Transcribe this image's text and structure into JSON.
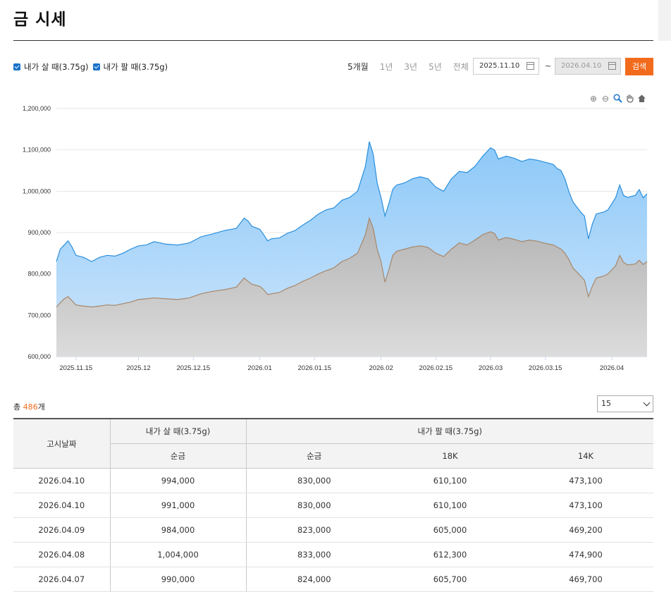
{
  "page": {
    "title": "금 시세"
  },
  "legend": {
    "buy_label": "내가 살 때(3.75g)",
    "sell_label": "내가 팔 때(3.75g)"
  },
  "periods": [
    "5개월",
    "1년",
    "3년",
    "5년",
    "전체"
  ],
  "date_range": {
    "start": "2025.11.10",
    "end": "2026.04.10",
    "separator": "~"
  },
  "search_label": "검색",
  "summary": {
    "prefix": "총 ",
    "count": "486",
    "suffix": "개"
  },
  "page_size": "15",
  "table": {
    "header_date": "고시날짜",
    "header_buy": "내가 살 때(3.75g)",
    "header_sell": "내가 팔 때(3.75g)",
    "sub": [
      "순금",
      "순금",
      "18K",
      "14K"
    ],
    "rows": [
      [
        "2026.04.10",
        "994,000",
        "830,000",
        "610,100",
        "473,100"
      ],
      [
        "2026.04.10",
        "991,000",
        "830,000",
        "610,100",
        "473,100"
      ],
      [
        "2026.04.09",
        "984,000",
        "823,000",
        "605,000",
        "469,200"
      ],
      [
        "2026.04.08",
        "1,004,000",
        "833,000",
        "612,300",
        "474,900"
      ],
      [
        "2026.04.07",
        "990,000",
        "824,000",
        "605,700",
        "469,700"
      ]
    ]
  },
  "colors": {
    "buy_fill": "#8cc8f8",
    "buy_line": "#2a8fdc",
    "sell_fill": "#b3b3b3",
    "sell_line": "#a8876a",
    "accent": "#f26b1d"
  },
  "chart_data": {
    "type": "area",
    "ylim": [
      600000,
      1200000
    ],
    "y_ticks": [
      "1,200,000",
      "1,100,000",
      "1,000,000",
      "900,000",
      "800,000",
      "700,000",
      "600,000"
    ],
    "x_ticks": [
      "2025.11.15",
      "2025.12",
      "2025.12.15",
      "2026.01",
      "2026.01.15",
      "2026.02",
      "2026.02.15",
      "2026.03",
      "2026.03.15",
      "2026.04"
    ],
    "x_range": [
      "2025.11.10",
      "2026.04.10"
    ],
    "grid": true,
    "series": [
      {
        "name": "내가 살 때(3.75g)",
        "points": [
          [
            "2025.11.10",
            830000
          ],
          [
            "2025.11.11",
            860000
          ],
          [
            "2025.11.12",
            870000
          ],
          [
            "2025.11.13",
            880000
          ],
          [
            "2025.11.14",
            865000
          ],
          [
            "2025.11.15",
            845000
          ],
          [
            "2025.11.17",
            840000
          ],
          [
            "2025.11.19",
            830000
          ],
          [
            "2025.11.21",
            840000
          ],
          [
            "2025.11.23",
            845000
          ],
          [
            "2025.11.25",
            843000
          ],
          [
            "2025.11.27",
            850000
          ],
          [
            "2025.11.29",
            860000
          ],
          [
            "2025.12.01",
            868000
          ],
          [
            "2025.12.03",
            870000
          ],
          [
            "2025.12.05",
            878000
          ],
          [
            "2025.12.08",
            872000
          ],
          [
            "2025.12.11",
            870000
          ],
          [
            "2025.12.14",
            875000
          ],
          [
            "2025.12.17",
            890000
          ],
          [
            "2025.12.20",
            897000
          ],
          [
            "2025.12.23",
            905000
          ],
          [
            "2025.12.26",
            910000
          ],
          [
            "2025.12.28",
            935000
          ],
          [
            "2025.12.29",
            928000
          ],
          [
            "2025.12.30",
            915000
          ],
          [
            "2026.01.01",
            908000
          ],
          [
            "2026.01.02",
            895000
          ],
          [
            "2026.01.03",
            880000
          ],
          [
            "2026.01.04",
            885000
          ],
          [
            "2026.01.06",
            887000
          ],
          [
            "2026.01.08",
            898000
          ],
          [
            "2026.01.10",
            905000
          ],
          [
            "2026.01.12",
            918000
          ],
          [
            "2026.01.14",
            930000
          ],
          [
            "2026.01.16",
            945000
          ],
          [
            "2026.01.18",
            955000
          ],
          [
            "2026.01.20",
            960000
          ],
          [
            "2026.01.22",
            978000
          ],
          [
            "2026.01.24",
            985000
          ],
          [
            "2026.01.26",
            1000000
          ],
          [
            "2026.01.28",
            1060000
          ],
          [
            "2026.01.29",
            1120000
          ],
          [
            "2026.01.30",
            1090000
          ],
          [
            "2026.01.31",
            1020000
          ],
          [
            "2026.02.01",
            985000
          ],
          [
            "2026.02.02",
            940000
          ],
          [
            "2026.02.03",
            970000
          ],
          [
            "2026.02.04",
            1005000
          ],
          [
            "2026.02.05",
            1015000
          ],
          [
            "2026.02.07",
            1020000
          ],
          [
            "2026.02.09",
            1030000
          ],
          [
            "2026.02.11",
            1035000
          ],
          [
            "2026.02.13",
            1030000
          ],
          [
            "2026.02.15",
            1010000
          ],
          [
            "2026.02.17",
            1000000
          ],
          [
            "2026.02.19",
            1030000
          ],
          [
            "2026.02.21",
            1048000
          ],
          [
            "2026.02.23",
            1045000
          ],
          [
            "2026.02.25",
            1060000
          ],
          [
            "2026.02.27",
            1085000
          ],
          [
            "2026.03.01",
            1105000
          ],
          [
            "2026.03.02",
            1100000
          ],
          [
            "2026.03.03",
            1078000
          ],
          [
            "2026.03.05",
            1085000
          ],
          [
            "2026.03.07",
            1080000
          ],
          [
            "2026.03.09",
            1072000
          ],
          [
            "2026.03.11",
            1078000
          ],
          [
            "2026.03.13",
            1075000
          ],
          [
            "2026.03.15",
            1070000
          ],
          [
            "2026.03.17",
            1065000
          ],
          [
            "2026.03.18",
            1055000
          ],
          [
            "2026.03.19",
            1050000
          ],
          [
            "2026.03.20",
            1030000
          ],
          [
            "2026.03.21",
            1000000
          ],
          [
            "2026.03.22",
            975000
          ],
          [
            "2026.03.24",
            950000
          ],
          [
            "2026.03.25",
            940000
          ],
          [
            "2026.03.26",
            885000
          ],
          [
            "2026.03.27",
            920000
          ],
          [
            "2026.03.28",
            945000
          ],
          [
            "2026.03.30",
            950000
          ],
          [
            "2026.03.31",
            955000
          ],
          [
            "2026.04.01",
            970000
          ],
          [
            "2026.04.02",
            985000
          ],
          [
            "2026.04.03",
            1015000
          ],
          [
            "2026.04.04",
            990000
          ],
          [
            "2026.04.05",
            985000
          ],
          [
            "2026.04.07",
            990000
          ],
          [
            "2026.04.08",
            1004000
          ],
          [
            "2026.04.09",
            984000
          ],
          [
            "2026.04.10",
            994000
          ]
        ]
      },
      {
        "name": "내가 팔 때(3.75g)",
        "points": [
          [
            "2025.11.10",
            720000
          ],
          [
            "2025.11.11",
            730000
          ],
          [
            "2025.11.12",
            740000
          ],
          [
            "2025.11.13",
            745000
          ],
          [
            "2025.11.14",
            735000
          ],
          [
            "2025.11.15",
            725000
          ],
          [
            "2025.11.17",
            722000
          ],
          [
            "2025.11.19",
            720000
          ],
          [
            "2025.11.21",
            722000
          ],
          [
            "2025.11.23",
            725000
          ],
          [
            "2025.11.25",
            724000
          ],
          [
            "2025.11.27",
            728000
          ],
          [
            "2025.11.29",
            732000
          ],
          [
            "2025.12.01",
            738000
          ],
          [
            "2025.12.03",
            740000
          ],
          [
            "2025.12.05",
            742000
          ],
          [
            "2025.12.08",
            740000
          ],
          [
            "2025.12.11",
            738000
          ],
          [
            "2025.12.14",
            742000
          ],
          [
            "2025.12.17",
            752000
          ],
          [
            "2025.12.20",
            758000
          ],
          [
            "2025.12.23",
            762000
          ],
          [
            "2025.12.26",
            768000
          ],
          [
            "2025.12.28",
            790000
          ],
          [
            "2025.12.29",
            782000
          ],
          [
            "2025.12.30",
            775000
          ],
          [
            "2026.01.01",
            770000
          ],
          [
            "2026.01.02",
            762000
          ],
          [
            "2026.01.03",
            750000
          ],
          [
            "2026.01.04",
            752000
          ],
          [
            "2026.01.06",
            755000
          ],
          [
            "2026.01.08",
            765000
          ],
          [
            "2026.01.10",
            772000
          ],
          [
            "2026.01.12",
            782000
          ],
          [
            "2026.01.14",
            790000
          ],
          [
            "2026.01.16",
            800000
          ],
          [
            "2026.01.18",
            808000
          ],
          [
            "2026.01.20",
            815000
          ],
          [
            "2026.01.22",
            830000
          ],
          [
            "2026.01.24",
            838000
          ],
          [
            "2026.01.26",
            850000
          ],
          [
            "2026.01.28",
            895000
          ],
          [
            "2026.01.29",
            935000
          ],
          [
            "2026.01.30",
            910000
          ],
          [
            "2026.01.31",
            860000
          ],
          [
            "2026.02.01",
            830000
          ],
          [
            "2026.02.02",
            780000
          ],
          [
            "2026.02.03",
            810000
          ],
          [
            "2026.02.04",
            845000
          ],
          [
            "2026.02.05",
            855000
          ],
          [
            "2026.02.07",
            860000
          ],
          [
            "2026.02.09",
            865000
          ],
          [
            "2026.02.11",
            868000
          ],
          [
            "2026.02.13",
            864000
          ],
          [
            "2026.02.15",
            850000
          ],
          [
            "2026.02.17",
            842000
          ],
          [
            "2026.02.19",
            860000
          ],
          [
            "2026.02.21",
            875000
          ],
          [
            "2026.02.23",
            870000
          ],
          [
            "2026.02.25",
            882000
          ],
          [
            "2026.02.27",
            895000
          ],
          [
            "2026.03.01",
            902000
          ],
          [
            "2026.03.02",
            898000
          ],
          [
            "2026.03.03",
            882000
          ],
          [
            "2026.03.05",
            888000
          ],
          [
            "2026.03.07",
            884000
          ],
          [
            "2026.03.09",
            878000
          ],
          [
            "2026.03.11",
            882000
          ],
          [
            "2026.03.13",
            879000
          ],
          [
            "2026.03.15",
            874000
          ],
          [
            "2026.03.17",
            870000
          ],
          [
            "2026.03.18",
            865000
          ],
          [
            "2026.03.19",
            860000
          ],
          [
            "2026.03.20",
            850000
          ],
          [
            "2026.03.21",
            835000
          ],
          [
            "2026.03.22",
            815000
          ],
          [
            "2026.03.24",
            795000
          ],
          [
            "2026.03.25",
            785000
          ],
          [
            "2026.03.26",
            745000
          ],
          [
            "2026.03.27",
            770000
          ],
          [
            "2026.03.28",
            790000
          ],
          [
            "2026.03.30",
            795000
          ],
          [
            "2026.03.31",
            800000
          ],
          [
            "2026.04.01",
            810000
          ],
          [
            "2026.04.02",
            820000
          ],
          [
            "2026.04.03",
            845000
          ],
          [
            "2026.04.04",
            828000
          ],
          [
            "2026.04.05",
            822000
          ],
          [
            "2026.04.07",
            824000
          ],
          [
            "2026.04.08",
            833000
          ],
          [
            "2026.04.09",
            823000
          ],
          [
            "2026.04.10",
            830000
          ]
        ]
      }
    ]
  }
}
